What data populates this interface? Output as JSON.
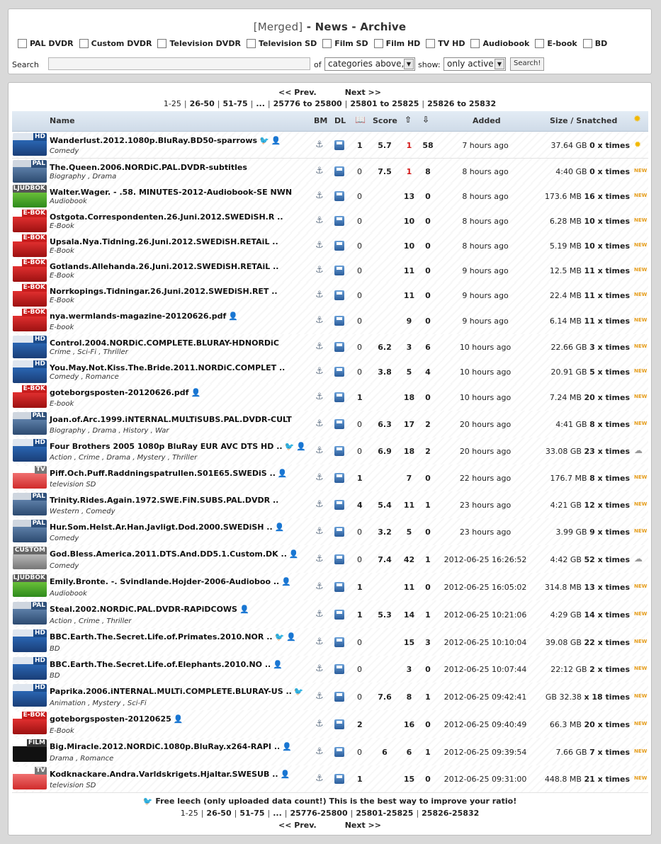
{
  "title": {
    "merged": "[Merged]",
    "rest": " - News - Archive"
  },
  "categories": [
    "PAL DVDR",
    "Custom DVDR",
    "Television DVDR",
    "Television SD",
    "Film SD",
    "Film HD",
    "TV HD",
    "Audiobook",
    "E-book",
    "BD"
  ],
  "search": {
    "label": "Search",
    "of_label": "of",
    "category_select": "categories above,",
    "show_label": "show:",
    "show_select": "only active",
    "button": "Search!"
  },
  "nav": {
    "prev": "<< Prev.",
    "next": "Next >>"
  },
  "pager_top": [
    "1-25",
    "26-50",
    "51-75",
    "...",
    "25776 to 25800",
    "25801 to 25825",
    "25826 to 25832"
  ],
  "pager_bottom": [
    "1-25",
    "26-50",
    "51-75",
    "...",
    "25776-25800",
    "25801-25825",
    "25826-25832"
  ],
  "headers": {
    "name": "Name",
    "bm": "BM",
    "dl": "DL",
    "score": "Score",
    "added": "Added",
    "size": "Size / Snatched"
  },
  "footnote": "Free leech (only uploaded data count!) This is the best way to improve your ratio!",
  "icons": {
    "bd": "HD",
    "pal": "PAL",
    "ljud": "LJUDBOK",
    "ebok": "E-BOK",
    "tv": "TV",
    "custom": "CUSTOM",
    "film": "FILM"
  },
  "rows": [
    {
      "icon": "bd",
      "name": "Wanderlust.2012.1080p.BluRay.BD50-sparrows",
      "genre": "Comedy",
      "bird": true,
      "user": true,
      "comments": "1",
      "score": "5.7",
      "seeders": "1",
      "seed_red": true,
      "leechers": "58",
      "added": "7 hours ago",
      "size": "37.64 GB",
      "snatched": "0 x times",
      "badge": "sun"
    },
    {
      "icon": "pal",
      "name": "The.Queen.2006.NORDiC.PAL.DVDR-subtitles",
      "genre": "Biography , Drama",
      "comments": "0",
      "score": "7.5",
      "seeders": "1",
      "seed_red": true,
      "leechers": "8",
      "added": "8 hours ago",
      "size": "4:40 GB",
      "snatched": "0 x times",
      "badge": "new"
    },
    {
      "icon": "ljud",
      "name": "Walter.Wager. - .58. MINUTES-2012-Audiobook-SE NWN",
      "genre": "Audiobook",
      "comments": "0",
      "score": "",
      "seeders": "13",
      "leechers": "0",
      "added": "8 hours ago",
      "size": "173.6 MB",
      "snatched": "16 x times",
      "badge": "new"
    },
    {
      "icon": "ebok",
      "name": "Ostgota.Correspondenten.26.Juni.2012.SWEDiSH.R ..",
      "genre": "E-Book",
      "comments": "0",
      "score": "",
      "seeders": "10",
      "leechers": "0",
      "added": "8 hours ago",
      "size": "6.28 MB",
      "snatched": "10 x times",
      "badge": "new"
    },
    {
      "icon": "ebok",
      "name": "Upsala.Nya.Tidning.26.Juni.2012.SWEDiSH.RETAiL ..",
      "genre": "E-Book",
      "comments": "0",
      "score": "",
      "seeders": "10",
      "leechers": "0",
      "added": "8 hours ago",
      "size": "5.19 MB",
      "snatched": "10 x times",
      "badge": "new"
    },
    {
      "icon": "ebok",
      "name": "Gotlands.Allehanda.26.Juni.2012.SWEDiSH.RETAiL ..",
      "genre": "E-Book",
      "comments": "0",
      "score": "",
      "seeders": "11",
      "leechers": "0",
      "added": "9 hours ago",
      "size": "12.5 MB",
      "snatched": "11 x times",
      "badge": "new"
    },
    {
      "icon": "ebok",
      "name": "Norrkopings.Tidningar.26.Juni.2012.SWEDiSH.RET ..",
      "genre": "E-Book",
      "comments": "0",
      "score": "",
      "seeders": "11",
      "leechers": "0",
      "added": "9 hours ago",
      "size": "22.4 MB",
      "snatched": "11 x times",
      "badge": "new"
    },
    {
      "icon": "ebok",
      "name": "nya.wermlands-magazine-20120626.pdf",
      "genre": "E-book",
      "user": true,
      "comments": "0",
      "score": "",
      "seeders": "9",
      "leechers": "0",
      "added": "9 hours ago",
      "size": "6.14 MB",
      "snatched": "11 x times",
      "badge": "new"
    },
    {
      "icon": "bd",
      "name": "Control.2004.NORDiC.COMPLETE.BLURAY-HDNORDiC",
      "genre": "Crime , Sci-Fi , Thriller",
      "comments": "0",
      "score": "6.2",
      "seeders": "3",
      "leechers": "6",
      "added": "10 hours ago",
      "size": "22.66 GB",
      "snatched": "3 x times",
      "badge": "new"
    },
    {
      "icon": "bd",
      "name": "You.May.Not.Kiss.The.Bride.2011.NORDiC.COMPLET ..",
      "genre": "Comedy , Romance",
      "comments": "0",
      "score": "3.8",
      "seeders": "5",
      "leechers": "4",
      "added": "10 hours ago",
      "size": "20.91 GB",
      "snatched": "5 x times",
      "badge": "new"
    },
    {
      "icon": "ebok",
      "name": "goteborgsposten-20120626.pdf",
      "genre": "E-book",
      "user": true,
      "comments": "1",
      "score": "",
      "seeders": "18",
      "leechers": "0",
      "added": "10 hours ago",
      "size": "7.24 MB",
      "snatched": "20 x times",
      "badge": "new"
    },
    {
      "icon": "pal",
      "name": "Joan.of.Arc.1999.iNTERNAL.MULTiSUBS.PAL.DVDR-CULT",
      "genre": "Biography , Drama , History , War",
      "comments": "0",
      "score": "6.3",
      "seeders": "17",
      "leechers": "2",
      "added": "20 hours ago",
      "size": "4:41 GB",
      "snatched": "8 x times",
      "badge": "new"
    },
    {
      "icon": "bd",
      "name": "Four Brothers 2005 1080p BluRay EUR AVC DTS HD ..",
      "genre": "Action , Crime , Drama , Mystery , Thriller",
      "bird": true,
      "user": true,
      "comments": "0",
      "score": "6.9",
      "seeders": "18",
      "leechers": "2",
      "added": "20 hours ago",
      "size": "33.08 GB",
      "snatched": "23 x times",
      "badge": "cloud"
    },
    {
      "icon": "tv",
      "name": "Piff.Och.Puff.Raddningspatrullen.S01E65.SWEDiS ..",
      "genre": "television SD",
      "user": true,
      "comments": "1",
      "score": "",
      "seeders": "7",
      "leechers": "0",
      "added": "22 hours ago",
      "size": "176.7 MB",
      "snatched": "8 x times",
      "badge": "new"
    },
    {
      "icon": "pal",
      "name": "Trinity.Rides.Again.1972.SWE.FiN.SUBS.PAL.DVDR ..",
      "genre": "Western , Comedy",
      "comments": "4",
      "score": "5.4",
      "seeders": "11",
      "leechers": "1",
      "added": "23 hours ago",
      "size": "4:21 GB",
      "snatched": "12 x times",
      "badge": "new"
    },
    {
      "icon": "pal",
      "name": "Hur.Som.Helst.Ar.Han.Javligt.Dod.2000.SWEDiSH ..",
      "genre": "Comedy",
      "user": true,
      "comments": "0",
      "score": "3.2",
      "seeders": "5",
      "leechers": "0",
      "added": "23 hours ago",
      "size": "3.99 GB",
      "snatched": "9 x times",
      "badge": "new"
    },
    {
      "icon": "custom",
      "name": "God.Bless.America.2011.DTS.And.DD5.1.Custom.DK ..",
      "genre": "Comedy",
      "user": true,
      "comments": "0",
      "score": "7.4",
      "seeders": "42",
      "leechers": "1",
      "added": "2012-06-25 16:26:52",
      "size": "4:42 GB",
      "snatched": "52 x times",
      "badge": "cloud"
    },
    {
      "icon": "ljud",
      "name": "Emily.Bronte. -. Svindlande.Hojder-2006-Audioboo ..",
      "genre": "Audiobook",
      "user": true,
      "comments": "1",
      "score": "",
      "seeders": "11",
      "leechers": "0",
      "added": "2012-06-25 16:05:02",
      "size": "314.8 MB",
      "snatched": "13 x times",
      "badge": "new"
    },
    {
      "icon": "pal",
      "name": "Steal.2002.NORDiC.PAL.DVDR-RAPiDCOWS",
      "genre": "Action , Crime , Thriller",
      "user": true,
      "comments": "1",
      "score": "5.3",
      "seeders": "14",
      "leechers": "1",
      "added": "2012-06-25 10:21:06",
      "size": "4:29 GB",
      "snatched": "14 x times",
      "badge": "new"
    },
    {
      "icon": "bd",
      "name": "BBC.Earth.The.Secret.Life.of.Primates.2010.NOR ..",
      "genre": "BD",
      "bird": true,
      "user": true,
      "comments": "0",
      "score": "",
      "seeders": "15",
      "leechers": "3",
      "added": "2012-06-25 10:10:04",
      "size": "39.08 GB",
      "snatched": "22 x times",
      "badge": "new"
    },
    {
      "icon": "bd",
      "name": "BBC.Earth.The.Secret.Life.of.Elephants.2010.NO ..",
      "genre": "BD",
      "user": true,
      "comments": "0",
      "score": "",
      "seeders": "3",
      "leechers": "0",
      "added": "2012-06-25 10:07:44",
      "size": "22:12 GB",
      "snatched": "2 x times",
      "badge": "new"
    },
    {
      "icon": "bd",
      "name": "Paprika.2006.iNTERNAL.MULTi.COMPLETE.BLURAY-US ..",
      "genre": "Animation , Mystery , Sci-Fi",
      "bird": true,
      "comments": "0",
      "score": "7.6",
      "seeders": "8",
      "leechers": "1",
      "added": "2012-06-25 09:42:41",
      "size": "GB 32.38",
      "snatched": "x 18 times",
      "badge": "new"
    },
    {
      "icon": "ebok",
      "name": "goteborgsposten-20120625",
      "genre": "E-Book",
      "user": true,
      "comments": "2",
      "score": "",
      "seeders": "16",
      "leechers": "0",
      "added": "2012-06-25 09:40:49",
      "size": "66.3 MB",
      "snatched": "20 x times",
      "badge": "new"
    },
    {
      "icon": "film",
      "name": "Big.Miracle.2012.NORDiC.1080p.BluRay.x264-RAPI ..",
      "genre": "Drama , Romance",
      "user": true,
      "comments": "0",
      "score": "6",
      "seeders": "6",
      "leechers": "1",
      "added": "2012-06-25 09:39:54",
      "size": "7.66 GB",
      "snatched": "7 x times",
      "badge": "new"
    },
    {
      "icon": "tv",
      "name": "Kodknackare.Andra.Varldskrigets.Hjaltar.SWESUB ..",
      "genre": "television SD",
      "user": true,
      "comments": "1",
      "score": "",
      "seeders": "15",
      "leechers": "0",
      "added": "2012-06-25 09:31:00",
      "size": "448.8 MB",
      "snatched": "21 x times",
      "badge": "new"
    }
  ]
}
